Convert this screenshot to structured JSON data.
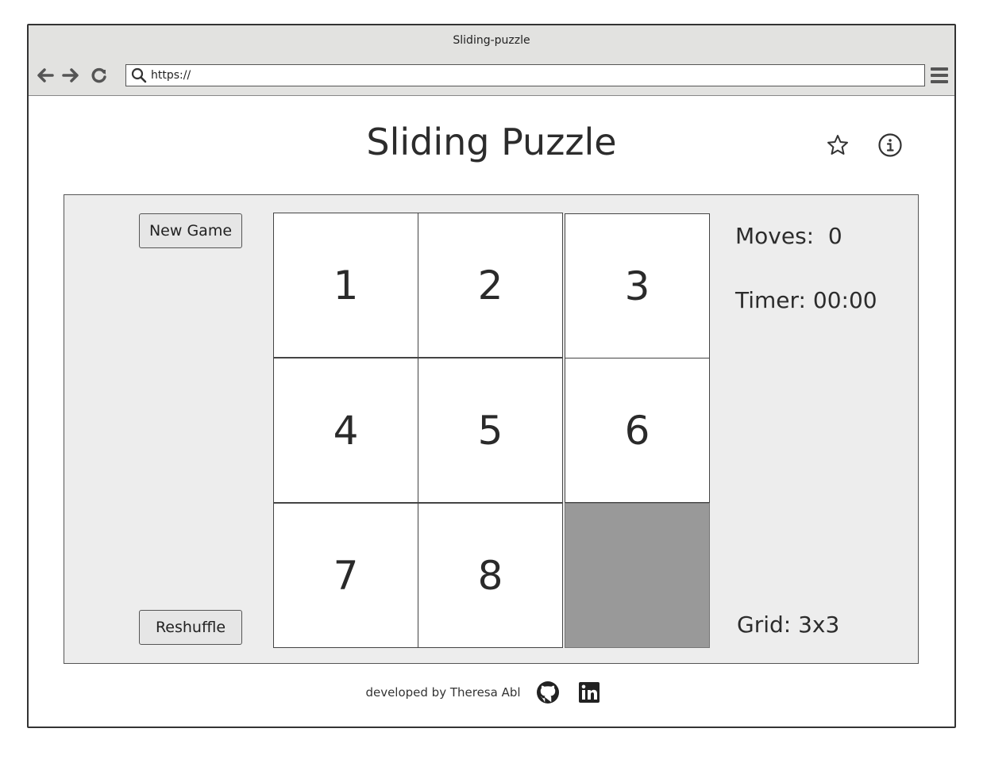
{
  "browser": {
    "window_title": "Sliding-puzzle",
    "url": "https://",
    "back_icon": "arrow-left-icon",
    "forward_icon": "arrow-right-icon",
    "reload_icon": "reload-icon",
    "search_icon": "search-icon",
    "menu_icon": "hamburger-menu-icon"
  },
  "header": {
    "title": "Sliding Puzzle",
    "icons": [
      "star-icon",
      "info-icon"
    ]
  },
  "controls": {
    "new_game_label": "New Game",
    "reshuffle_label": "Reshuffle"
  },
  "board": {
    "grid_size": 3,
    "tiles": [
      {
        "label": "1"
      },
      {
        "label": "2"
      },
      {
        "label": "3"
      },
      {
        "label": "4"
      },
      {
        "label": "5"
      },
      {
        "label": "6"
      },
      {
        "label": "7"
      },
      {
        "label": "8"
      },
      {
        "label": ""
      }
    ],
    "empty_color": "#999999"
  },
  "stats": {
    "moves_label": "Moves:  0",
    "timer_label": "Timer: 00:00",
    "grid_label": "Grid: 3x3"
  },
  "footer": {
    "credit": "developed by Theresa Abl",
    "icons": [
      "github-icon",
      "linkedin-icon"
    ]
  }
}
